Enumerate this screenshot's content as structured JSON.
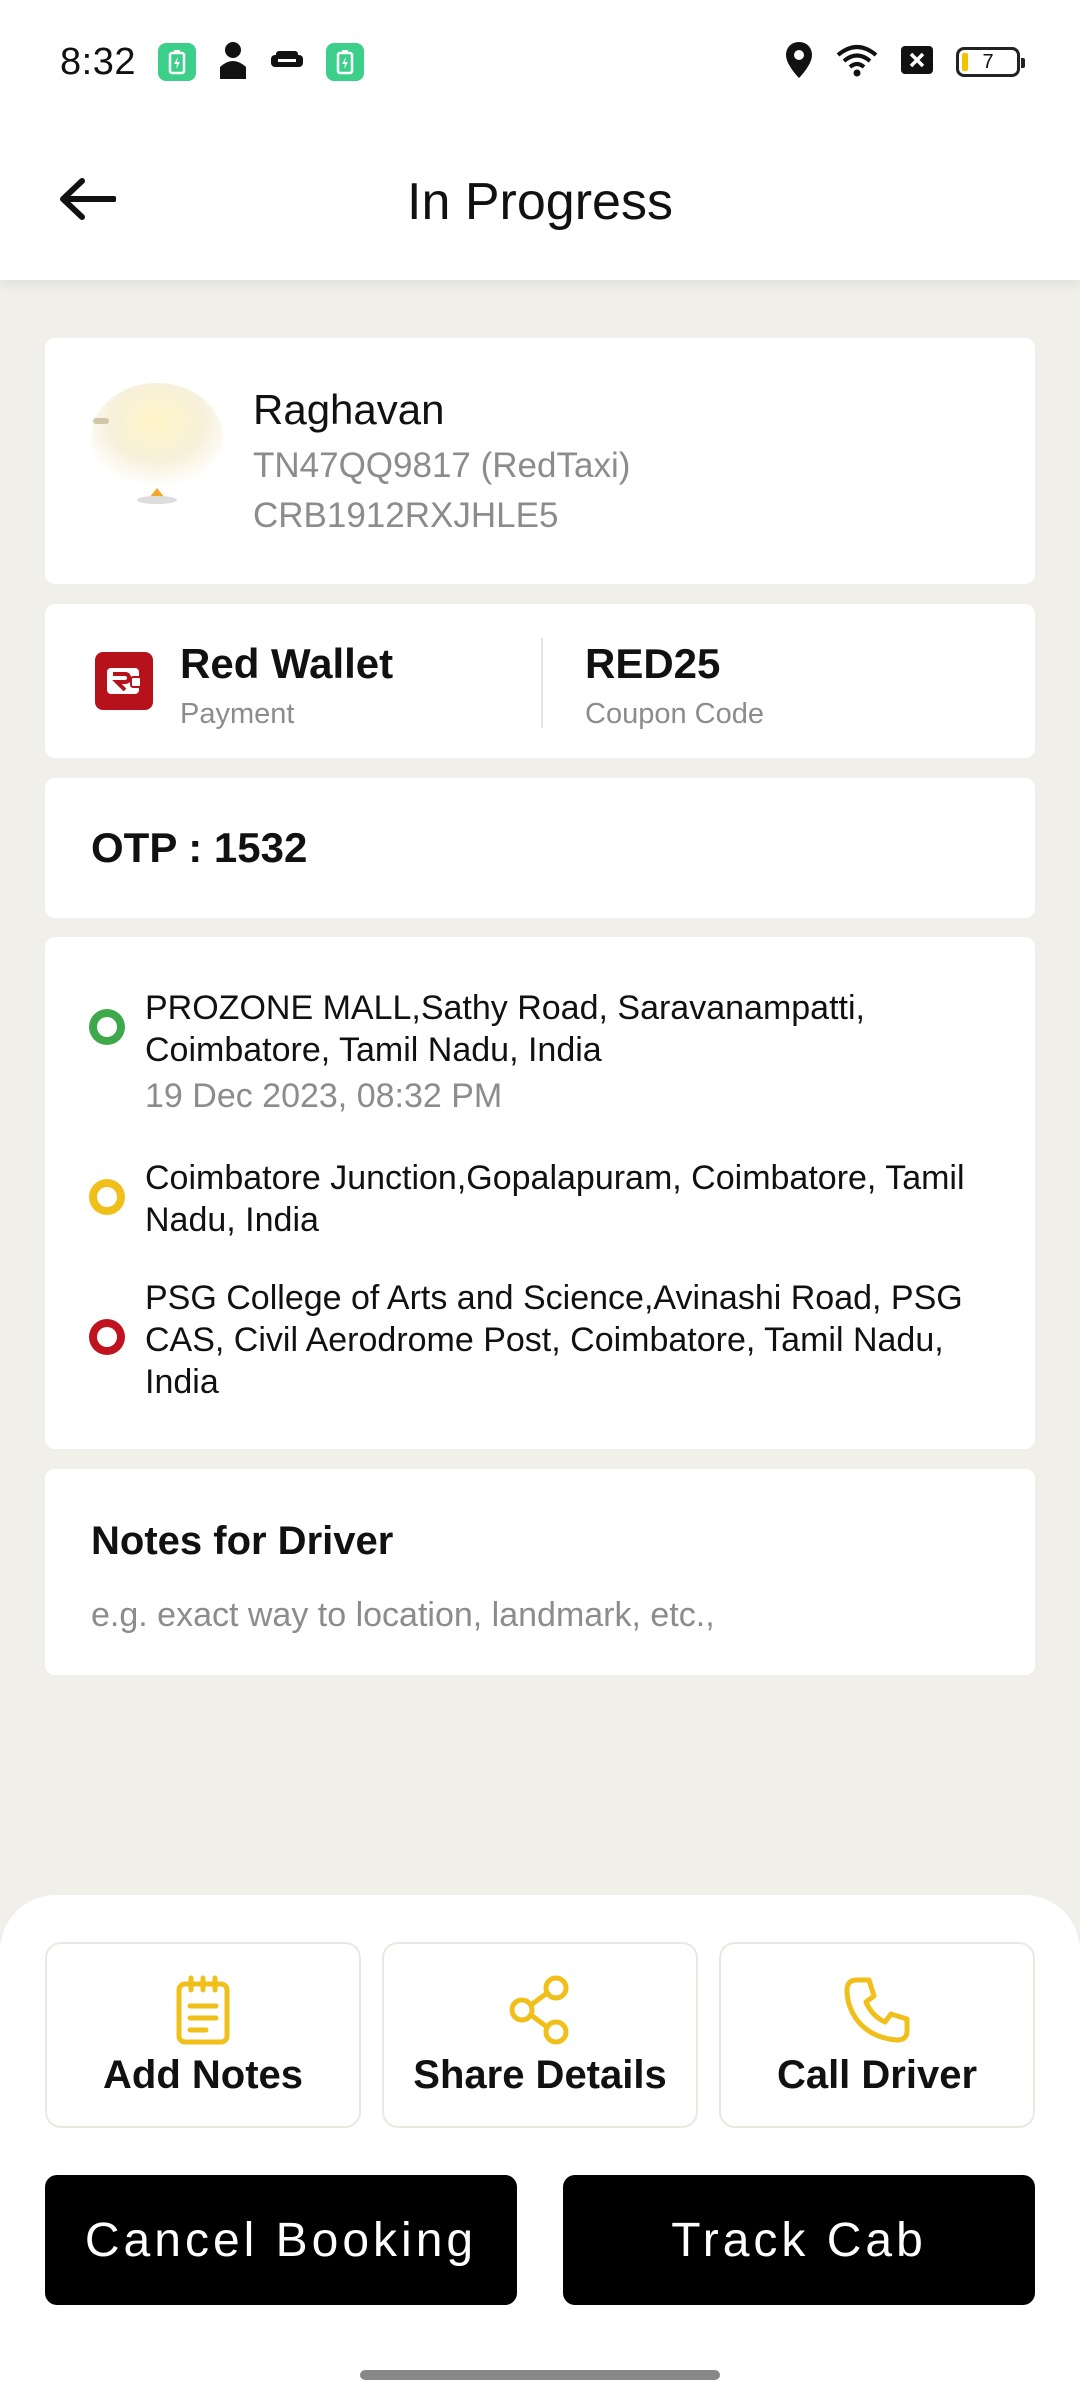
{
  "status_bar": {
    "time": "8:32",
    "battery_level": "7",
    "icons": [
      "battery-saver-icon",
      "person-icon",
      "car-icon",
      "battery-saver-icon",
      "location-icon",
      "wifi-icon",
      "no-sim-icon",
      "battery-icon"
    ]
  },
  "header": {
    "title": "In Progress",
    "back_icon": "arrow-left-icon"
  },
  "driver": {
    "name": "Raghavan",
    "vehicle": "TN47QQ9817 (RedTaxi)",
    "booking_id": "CRB1912RXJHLE5"
  },
  "payment": {
    "method": "Red Wallet",
    "method_label": "Payment",
    "coupon": "RED25",
    "coupon_label": "Coupon Code"
  },
  "otp": {
    "text": "OTP : 1532"
  },
  "route": {
    "stops": [
      {
        "address": "PROZONE MALL,Sathy Road, Saravanampatti, Coimbatore, Tamil Nadu, India",
        "time": "19 Dec 2023, 08:32 PM",
        "color": "#3ea94a"
      },
      {
        "address": "Coimbatore Junction,Gopalapuram, Coimbatore, Tamil Nadu, India",
        "color": "#f0bf1a"
      },
      {
        "address": "PSG College of Arts and Science,Avinashi Road, PSG CAS, Civil Aerodrome Post, Coimbatore, Tamil Nadu, India",
        "color": "#c1121f"
      }
    ]
  },
  "notes": {
    "title": "Notes for Driver",
    "placeholder": "e.g. exact way to location, landmark, etc.,",
    "value": ""
  },
  "actions": {
    "add_notes": "Add Notes",
    "share_details": "Share Details",
    "call_driver": "Call Driver",
    "accent_color": "#f0bf1a"
  },
  "buttons": {
    "cancel": "Cancel Booking",
    "track": "Track Cab"
  }
}
